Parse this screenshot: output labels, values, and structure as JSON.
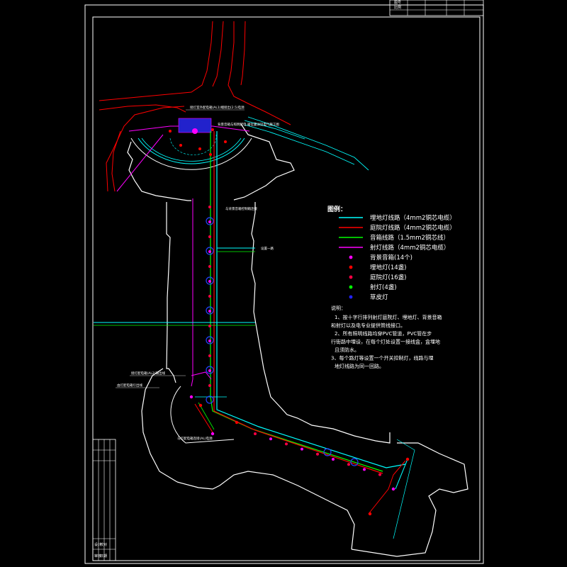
{
  "legend": {
    "title": "图例：",
    "items": [
      {
        "kind": "line",
        "color": "#00ffff",
        "label": "埋地灯线路（4mm2铜芯电缆）"
      },
      {
        "kind": "line",
        "color": "#ff0000",
        "label": "庭院灯线路（4mm2铜芯电缆）"
      },
      {
        "kind": "line",
        "color": "#00ff00",
        "label": "音箱线路（1.5mm2铜芯线）"
      },
      {
        "kind": "line",
        "color": "#ff00ff",
        "label": "射灯线路（4mm2铜芯电缆）"
      },
      {
        "kind": "dot",
        "color": "#ff00ff",
        "label": "背景音箱(14个)"
      },
      {
        "kind": "dot",
        "color": "#ff0000",
        "label": "埋地灯(14盏)"
      },
      {
        "kind": "dot",
        "color": "#ff0044",
        "label": "庭院灯(16盏)"
      },
      {
        "kind": "dot",
        "color": "#00ff00",
        "label": "射灯(4盏)"
      },
      {
        "kind": "dot",
        "color": "#2222ff",
        "label": "草皮灯"
      }
    ]
  },
  "notes": {
    "heading": "说明：",
    "lines": [
      "1、按十字行排列射灯庭院灯、埋地灯、背景音箱",
      "和射灯以及电专业提供管线接口。",
      "2、所有照明线路均穿PVC管道，PVC管在步",
      "行街路中埋设，在每个灯处设置一接线盒，盒埋地",
      "且须防水。",
      "3、每个路灯等设置一个开关控制灯，线路与埋",
      "地灯线路为同一回路。"
    ]
  },
  "annotations": {
    "top": "接灯室外配电箱(AL1)端接出(2.5)电源",
    "plaza_label": "背景音箱与照明配电\n箱位置详见电气施工图",
    "mid_right": "与背景音箱控制箱连接",
    "branch": "设置一路",
    "lower_left_1": "接灯配电箱(AL2)输出线",
    "lower_left_2": "由灯配电箱引出线",
    "bottom": "与灯配电箱连接(AL)电源"
  },
  "title_block": {
    "top_right": [
      "图号",
      "比例"
    ],
    "side": [
      "设计",
      "校对",
      "审核",
      "日期"
    ]
  },
  "colors": {
    "background": "#000000",
    "frame": "#ffffff",
    "road": "#ff0000",
    "buried_light_line": "#00ffff",
    "garden_light_line": "#ff0000",
    "speaker_line": "#00ff00",
    "spotlight_line": "#ff00ff"
  }
}
